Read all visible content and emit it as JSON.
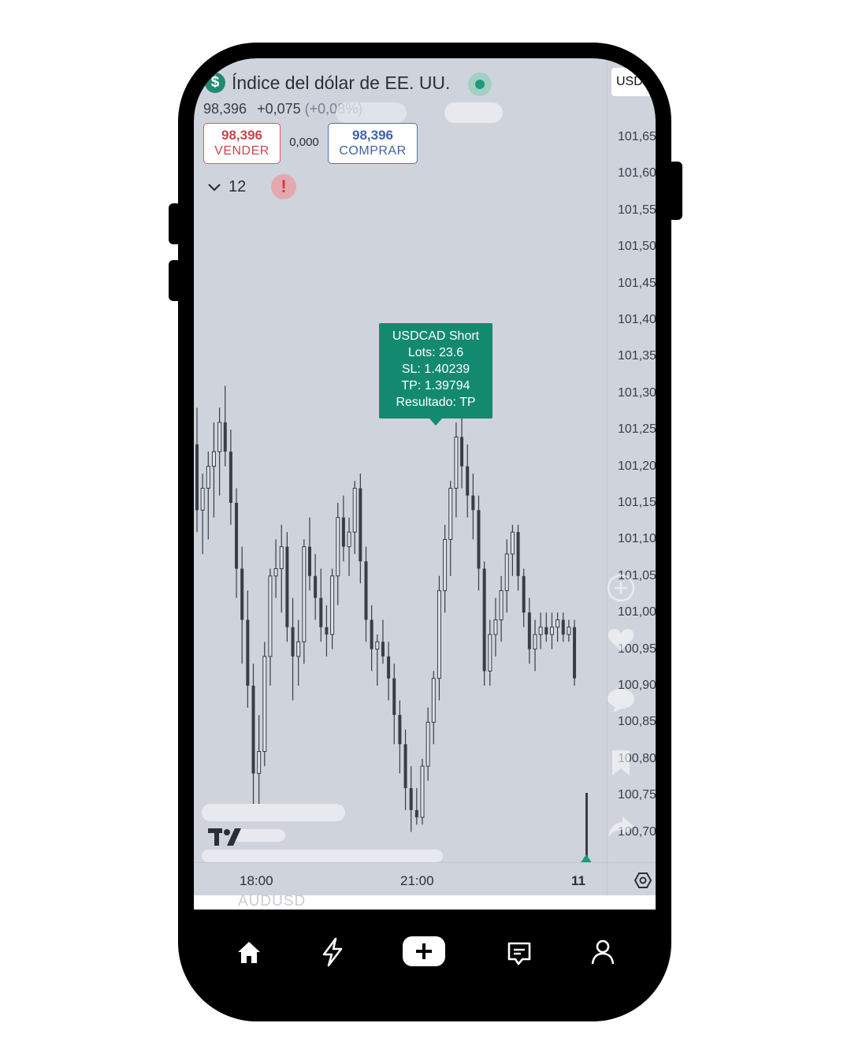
{
  "header": {
    "title": "Índice del dólar de EE. UU.",
    "price": "98,396",
    "change": "+0,075",
    "change_pct": "(+0,08%)",
    "currency": "USD"
  },
  "trade": {
    "sell_price": "98,396",
    "sell_label": "VENDER",
    "spread": "0,000",
    "buy_price": "98,396",
    "buy_label": "COMPRAR"
  },
  "indicators": {
    "count": "12"
  },
  "price_scale": [
    "101,65",
    "101,60",
    "101,55",
    "101,50",
    "101,45",
    "101,40",
    "101,35",
    "101,30",
    "101,25",
    "101,20",
    "101,15",
    "101,10",
    "101,05",
    "101,00",
    "100,95",
    "100,90",
    "100,85",
    "100,80",
    "100,75",
    "100,70"
  ],
  "time_axis": {
    "t1": "18:00",
    "t2": "21:00",
    "t3": "11"
  },
  "tooltip": {
    "line1": "USDCAD Short",
    "line2": "Lots: 23.6",
    "line3": "SL: 1.40239",
    "line4": "TP: 1.39794",
    "line5": "Resultado: TP"
  },
  "footer_symbol": "AUDUSD",
  "colors": {
    "screen_bg": "#cfd3dc",
    "accent": "#138a6f",
    "sell": "#c8454f",
    "buy": "#3f62a8",
    "candle": "#3a3d44"
  },
  "nav": {
    "icons": [
      "home-icon",
      "bolt-icon",
      "plus-icon",
      "chat-icon",
      "user-icon"
    ]
  },
  "chart_data": {
    "type": "candlestick",
    "ylim": [
      100.68,
      101.69
    ],
    "candles": [
      [
        101.23,
        101.28,
        101.11,
        101.14
      ],
      [
        101.14,
        101.19,
        101.08,
        101.17
      ],
      [
        101.17,
        101.22,
        101.1,
        101.2
      ],
      [
        101.2,
        101.26,
        101.13,
        101.22
      ],
      [
        101.22,
        101.28,
        101.16,
        101.26
      ],
      [
        101.26,
        101.31,
        101.2,
        101.22
      ],
      [
        101.22,
        101.25,
        101.12,
        101.15
      ],
      [
        101.15,
        101.17,
        101.02,
        101.06
      ],
      [
        101.06,
        101.09,
        100.93,
        100.99
      ],
      [
        100.99,
        101.03,
        100.87,
        100.9
      ],
      [
        100.9,
        100.93,
        100.73,
        100.78
      ],
      [
        100.78,
        100.86,
        100.72,
        100.81
      ],
      [
        100.81,
        100.96,
        100.79,
        100.94
      ],
      [
        100.94,
        101.06,
        100.9,
        101.05
      ],
      [
        101.05,
        101.1,
        101.02,
        101.06
      ],
      [
        101.06,
        101.12,
        101.0,
        101.09
      ],
      [
        101.09,
        101.11,
        100.96,
        100.98
      ],
      [
        100.98,
        101.02,
        100.88,
        100.94
      ],
      [
        100.94,
        100.99,
        100.9,
        100.96
      ],
      [
        100.96,
        101.1,
        100.93,
        101.09
      ],
      [
        101.09,
        101.13,
        101.03,
        101.05
      ],
      [
        101.05,
        101.08,
        100.99,
        101.02
      ],
      [
        101.02,
        101.06,
        100.96,
        100.98
      ],
      [
        100.98,
        101.01,
        100.94,
        100.97
      ],
      [
        100.97,
        101.06,
        100.95,
        101.05
      ],
      [
        101.05,
        101.15,
        101.01,
        101.13
      ],
      [
        101.13,
        101.16,
        101.07,
        101.09
      ],
      [
        101.09,
        101.13,
        101.05,
        101.11
      ],
      [
        101.11,
        101.18,
        101.08,
        101.17
      ],
      [
        101.17,
        101.19,
        101.04,
        101.07
      ],
      [
        101.07,
        101.09,
        100.96,
        100.99
      ],
      [
        100.99,
        101.01,
        100.92,
        100.95
      ],
      [
        100.95,
        100.97,
        100.9,
        100.96
      ],
      [
        100.96,
        100.99,
        100.93,
        100.94
      ],
      [
        100.94,
        100.96,
        100.88,
        100.91
      ],
      [
        100.91,
        100.93,
        100.82,
        100.86
      ],
      [
        100.86,
        100.88,
        100.78,
        100.82
      ],
      [
        100.82,
        100.84,
        100.73,
        100.76
      ],
      [
        100.76,
        100.79,
        100.7,
        100.73
      ],
      [
        100.73,
        100.76,
        100.71,
        100.72
      ],
      [
        100.72,
        100.8,
        100.71,
        100.79
      ],
      [
        100.79,
        100.87,
        100.77,
        100.85
      ],
      [
        100.85,
        100.92,
        100.82,
        100.91
      ],
      [
        100.91,
        101.05,
        100.88,
        101.03
      ],
      [
        101.03,
        101.12,
        101.0,
        101.1
      ],
      [
        101.1,
        101.18,
        101.05,
        101.17
      ],
      [
        101.17,
        101.26,
        101.13,
        101.24
      ],
      [
        101.24,
        101.27,
        101.17,
        101.2
      ],
      [
        101.2,
        101.23,
        101.13,
        101.16
      ],
      [
        101.16,
        101.19,
        101.1,
        101.14
      ],
      [
        101.14,
        101.16,
        101.03,
        101.06
      ],
      [
        101.06,
        101.07,
        100.9,
        100.92
      ],
      [
        100.92,
        100.99,
        100.9,
        100.97
      ],
      [
        100.97,
        101.02,
        100.94,
        100.99
      ],
      [
        100.99,
        101.05,
        100.96,
        101.03
      ],
      [
        101.03,
        101.1,
        101.0,
        101.08
      ],
      [
        101.08,
        101.12,
        101.05,
        101.11
      ],
      [
        101.11,
        101.12,
        101.03,
        101.05
      ],
      [
        101.05,
        101.06,
        100.98,
        101.0
      ],
      [
        101.0,
        101.02,
        100.93,
        100.95
      ],
      [
        100.95,
        100.99,
        100.92,
        100.97
      ],
      [
        100.97,
        101.0,
        100.95,
        100.98
      ],
      [
        100.98,
        101.0,
        100.96,
        100.97
      ],
      [
        100.97,
        101.0,
        100.95,
        100.98
      ],
      [
        100.98,
        101.0,
        100.96,
        100.99
      ],
      [
        100.99,
        101.0,
        100.96,
        100.97
      ],
      [
        100.97,
        100.99,
        100.96,
        100.98
      ],
      [
        100.98,
        100.99,
        100.9,
        100.91
      ]
    ]
  }
}
